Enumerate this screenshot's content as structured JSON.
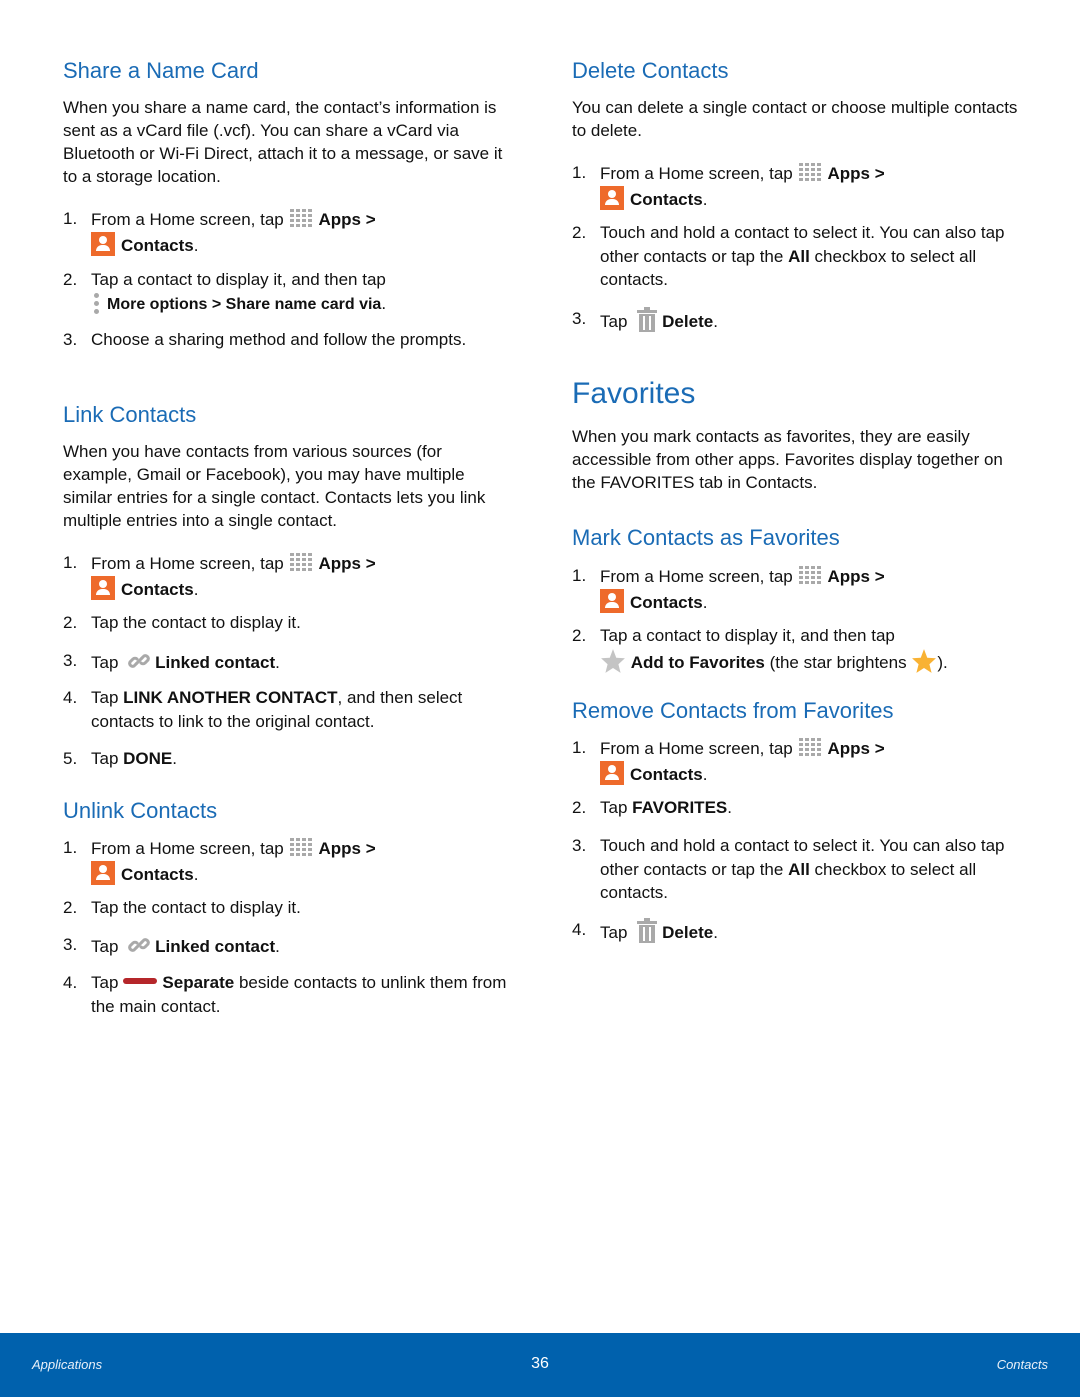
{
  "left": {
    "share": {
      "heading": "Share a Name Card",
      "para": "When you share a name card, the contact’s information is sent as a vCard file (.vcf). You can share a vCard via Bluetooth or Wi-Fi Direct, attach it to a message, or save it to a storage location.",
      "steps": [
        {
          "num": "1.",
          "pre": "From a Home screen, tap",
          "apps": "Apps",
          "gt": ">",
          "contacts": "Contacts",
          "end": "."
        },
        {
          "num": "2.",
          "pre": "Tap a contact to display it, and then tap",
          "bold": "More options > Share name card via",
          "end": "."
        },
        {
          "num": "3.",
          "text": "Choose a sharing method and follow the prompts."
        }
      ]
    },
    "link": {
      "heading": "Link Contacts",
      "para": "When you have contacts from various sources (for example, Gmail or Facebook), you may have multiple similar entries for a single contact. Contacts lets you link multiple entries into a single contact.",
      "steps": [
        {
          "num": "1.",
          "pre": "From a Home screen, tap",
          "apps": "Apps",
          "gt": ">",
          "contacts": "Contacts",
          "end": "."
        },
        {
          "num": "2.",
          "text": "Tap the contact to display it."
        },
        {
          "num": "3.",
          "pre": "Tap",
          "bold": "Linked contact",
          "end": "."
        },
        {
          "num": "4.",
          "pre": "Tap",
          "bold": "LINK ANOTHER CONTACT",
          "post": ", and then select contacts to link to the original contact."
        },
        {
          "num": "5.",
          "pre": "Tap",
          "bold": "DONE",
          "end": "."
        }
      ]
    },
    "unlink": {
      "heading": "Unlink Contacts",
      "steps": [
        {
          "num": "1.",
          "pre": "From a Home screen, tap",
          "apps": "Apps",
          "gt": ">",
          "contacts": "Contacts",
          "end": "."
        },
        {
          "num": "2.",
          "text": "Tap the contact to display it."
        },
        {
          "num": "3.",
          "pre": "Tap",
          "bold": "Linked contact",
          "end": "."
        },
        {
          "num": "4.",
          "pre": "Tap",
          "bold": "Separate",
          "post": " beside contacts to unlink them from the main contact."
        }
      ]
    }
  },
  "right": {
    "delete": {
      "heading": "Delete Contacts",
      "para": "You can delete a single contact or choose multiple contacts to delete.",
      "steps": [
        {
          "num": "1.",
          "pre": "From a Home screen, tap",
          "apps": "Apps",
          "gt": ">",
          "contacts": "Contacts",
          "end": "."
        },
        {
          "num": "2.",
          "pre": "Touch and hold a contact to select it. You can also tap other contacts or tap the",
          "bold": "All",
          "post": " checkbox to select all contacts."
        },
        {
          "num": "3.",
          "pre": "Tap",
          "bold": "Delete",
          "end": "."
        }
      ]
    },
    "favorites": {
      "heading": "Favorites",
      "para": "When you mark contacts as favorites, they are easily accessible from other apps. Favorites display together on the FAVORITES tab in Contacts."
    },
    "mark": {
      "heading": "Mark Contacts as Favorites",
      "steps": [
        {
          "num": "1.",
          "pre": "From a Home screen, tap",
          "apps": "Apps",
          "gt": ">",
          "contacts": "Contacts",
          "end": "."
        },
        {
          "num": "2.",
          "pre": "Tap a contact to display it, and then tap",
          "bold": "Add to Favorites",
          "post": " (the star brightens",
          "end": ")."
        }
      ]
    },
    "remove": {
      "heading": "Remove Contacts from Favorites",
      "steps": [
        {
          "num": "1.",
          "pre": "From a Home screen, tap",
          "apps": "Apps",
          "gt": ">",
          "contacts": "Contacts",
          "end": "."
        },
        {
          "num": "2.",
          "pre": "Tap",
          "bold": "FAVORITES",
          "end": "."
        },
        {
          "num": "3.",
          "pre": "Touch and hold a contact to select it. You can also tap other contacts or tap the",
          "bold": "All",
          "post": " checkbox to select all contacts."
        },
        {
          "num": "4.",
          "pre": "Tap",
          "bold": "Delete",
          "end": "."
        }
      ]
    }
  },
  "footer": {
    "left": "Applications",
    "page": "36",
    "right": "Contacts"
  },
  "colors": {
    "heading": "#1a6bb5",
    "footer_bg": "#0061ad",
    "contacts_icon": "#ee6a2b",
    "separate_icon": "#b5262a",
    "star_active": "#f9a825",
    "icon_gray": "#a9a9a9"
  }
}
